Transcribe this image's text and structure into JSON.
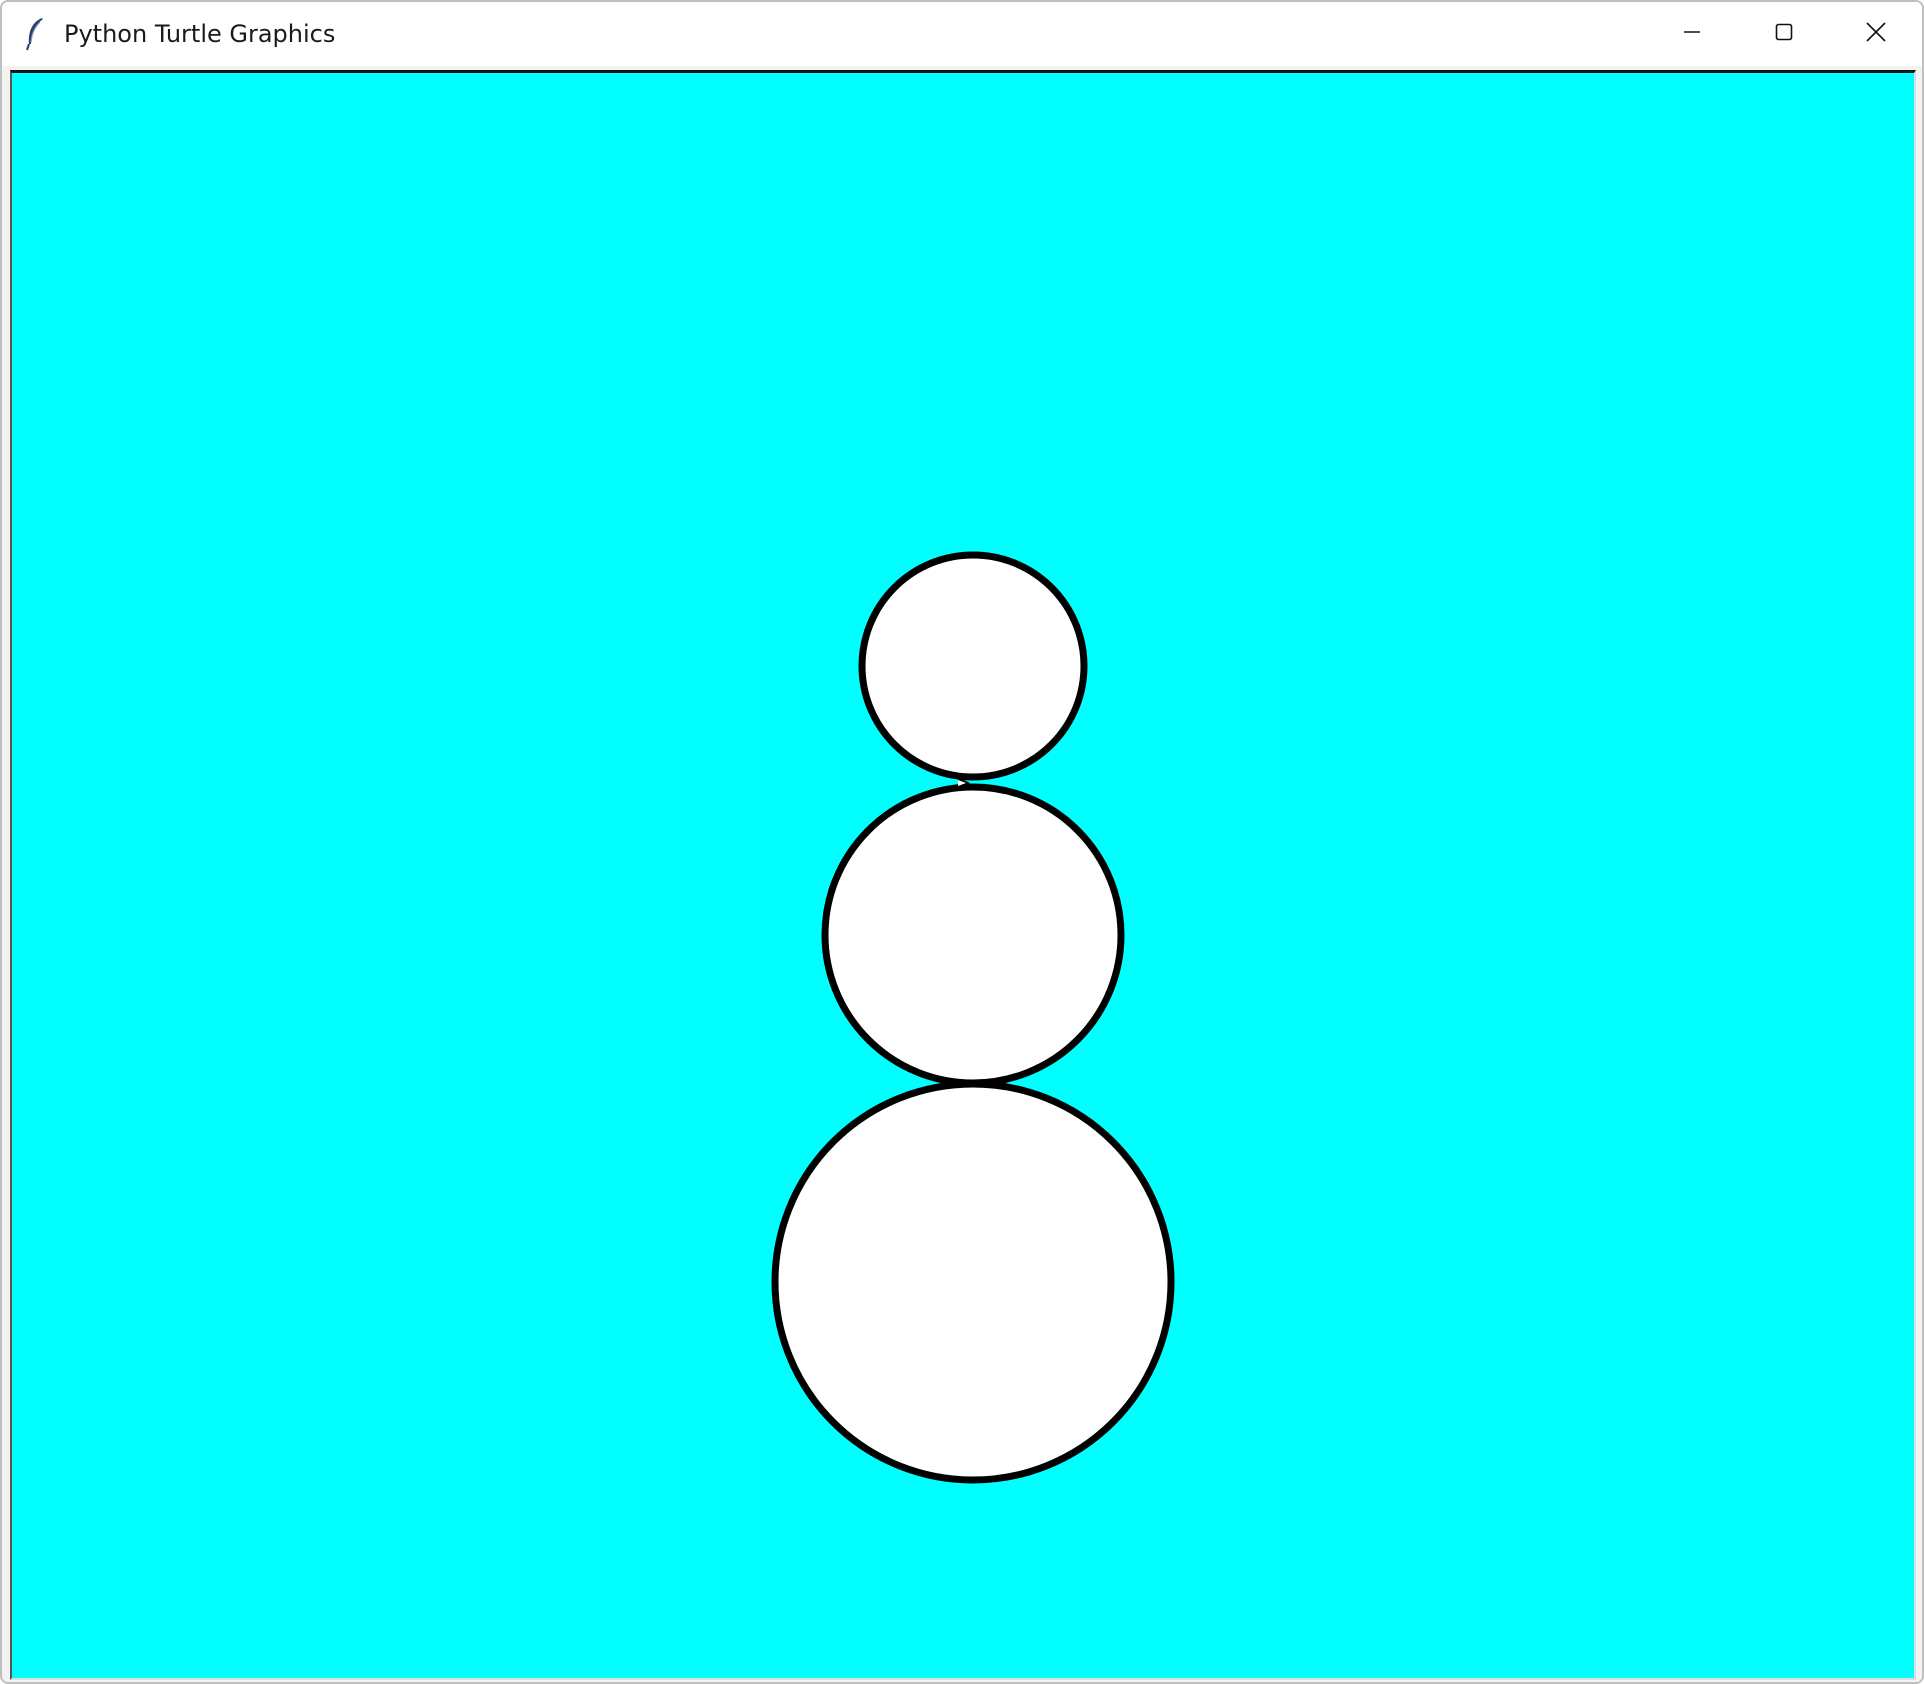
{
  "window": {
    "title": "Python Turtle Graphics",
    "app_icon": "feather-icon",
    "controls": [
      "minimize-icon",
      "maximize-icon",
      "close-icon"
    ]
  },
  "canvas": {
    "background": "#00ffff",
    "shape_fill": "#ffffff",
    "shape_stroke": "#000000",
    "shapes": [
      "head-circle",
      "middle-circle",
      "bottom-circle"
    ],
    "turtle_cursor": "arrow-cursor-icon"
  }
}
